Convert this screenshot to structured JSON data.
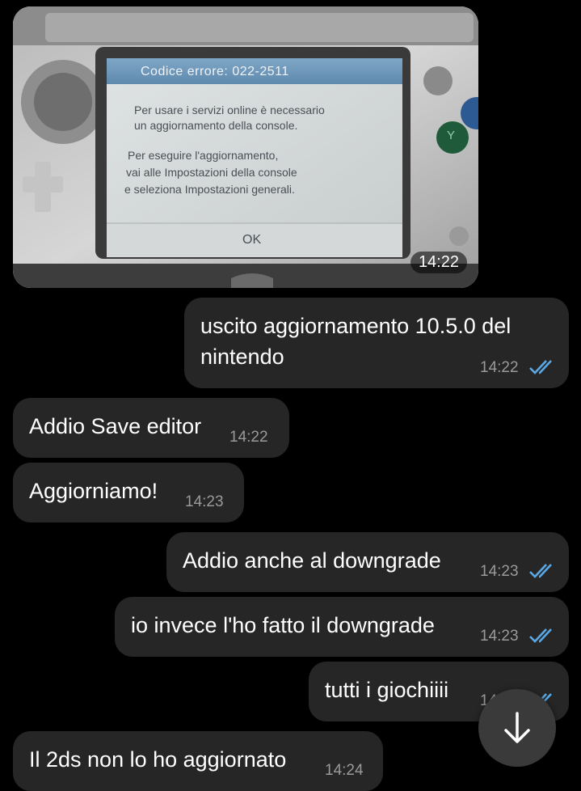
{
  "photo_message": {
    "screen": {
      "error_title": "Codice errore: 022-2511",
      "line1": "Per usare i servizi online è necessario",
      "line2": "un aggiornamento della console.",
      "line3": "Per eseguire l'aggiornamento,",
      "line4": "vai alle Impostazioni della console",
      "line5": "e seleziona Impostazioni generali.",
      "ok_label": "OK"
    },
    "device_button_label": "Y",
    "time": "14:22"
  },
  "messages": [
    {
      "id": "m1",
      "direction": "outgoing",
      "lines": [
        "uscito aggiornamento 10.5.0 del",
        "nintendo"
      ],
      "time": "14:22",
      "read": true
    },
    {
      "id": "m2",
      "direction": "incoming",
      "lines": [
        "Addio Save editor"
      ],
      "time": "14:22"
    },
    {
      "id": "m3",
      "direction": "incoming",
      "lines": [
        "Aggiorniamo!"
      ],
      "time": "14:23"
    },
    {
      "id": "m4",
      "direction": "outgoing",
      "lines": [
        "Addio anche al downgrade"
      ],
      "time": "14:23",
      "read": true
    },
    {
      "id": "m5",
      "direction": "outgoing",
      "lines": [
        "io invece l'ho fatto il downgrade"
      ],
      "time": "14:23",
      "read": true
    },
    {
      "id": "m6",
      "direction": "outgoing",
      "lines": [
        "tutti i giochiiii"
      ],
      "time": "14:23",
      "read": true
    },
    {
      "id": "m7",
      "direction": "incoming",
      "lines": [
        "Il 2ds non lo ho aggiornato"
      ],
      "time": "14:24"
    }
  ],
  "scroll_down_icon": "arrow-down-icon",
  "colors": {
    "background": "#000000",
    "bubble": "#262626",
    "read_ticks": "#5aa9e6",
    "timestamp": "#9a9a9a",
    "fab": "#3a3a3a"
  }
}
